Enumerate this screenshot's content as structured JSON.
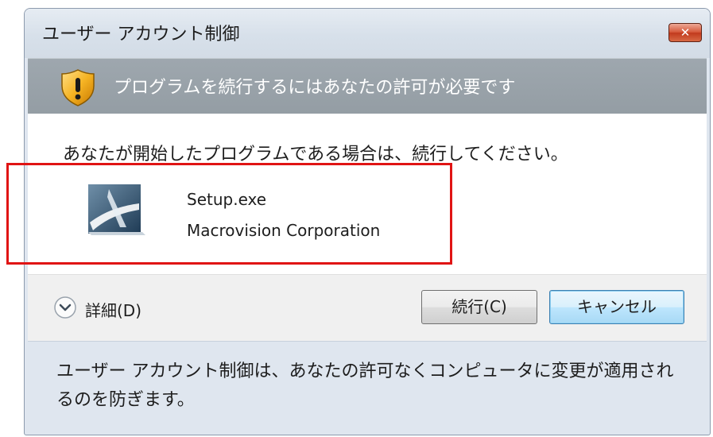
{
  "dialog": {
    "title": "ユーザー アカウント制御",
    "close_label": "✕",
    "banner_text": "プログラムを続行するにはあなたの許可が必要です",
    "instruction": "あなたが開始したプログラムである場合は、続行してください。",
    "program_name": "Setup.exe",
    "publisher": "Macrovision Corporation",
    "details_label": "詳細(D)",
    "continue_label": "続行(C)",
    "cancel_label": "キャンセル",
    "footer_text": "ユーザー アカウント制御は、あなたの許可なくコンピュータに変更が適用されるのを防ぎます。"
  },
  "icons": {
    "shield": "shield-warning-icon",
    "program": "setup-program-icon",
    "details": "chevron-down-icon",
    "close": "close-icon"
  },
  "colors": {
    "banner": "#9ea7ae",
    "highlight": "#e01414",
    "close_button": "#c13a1d"
  }
}
